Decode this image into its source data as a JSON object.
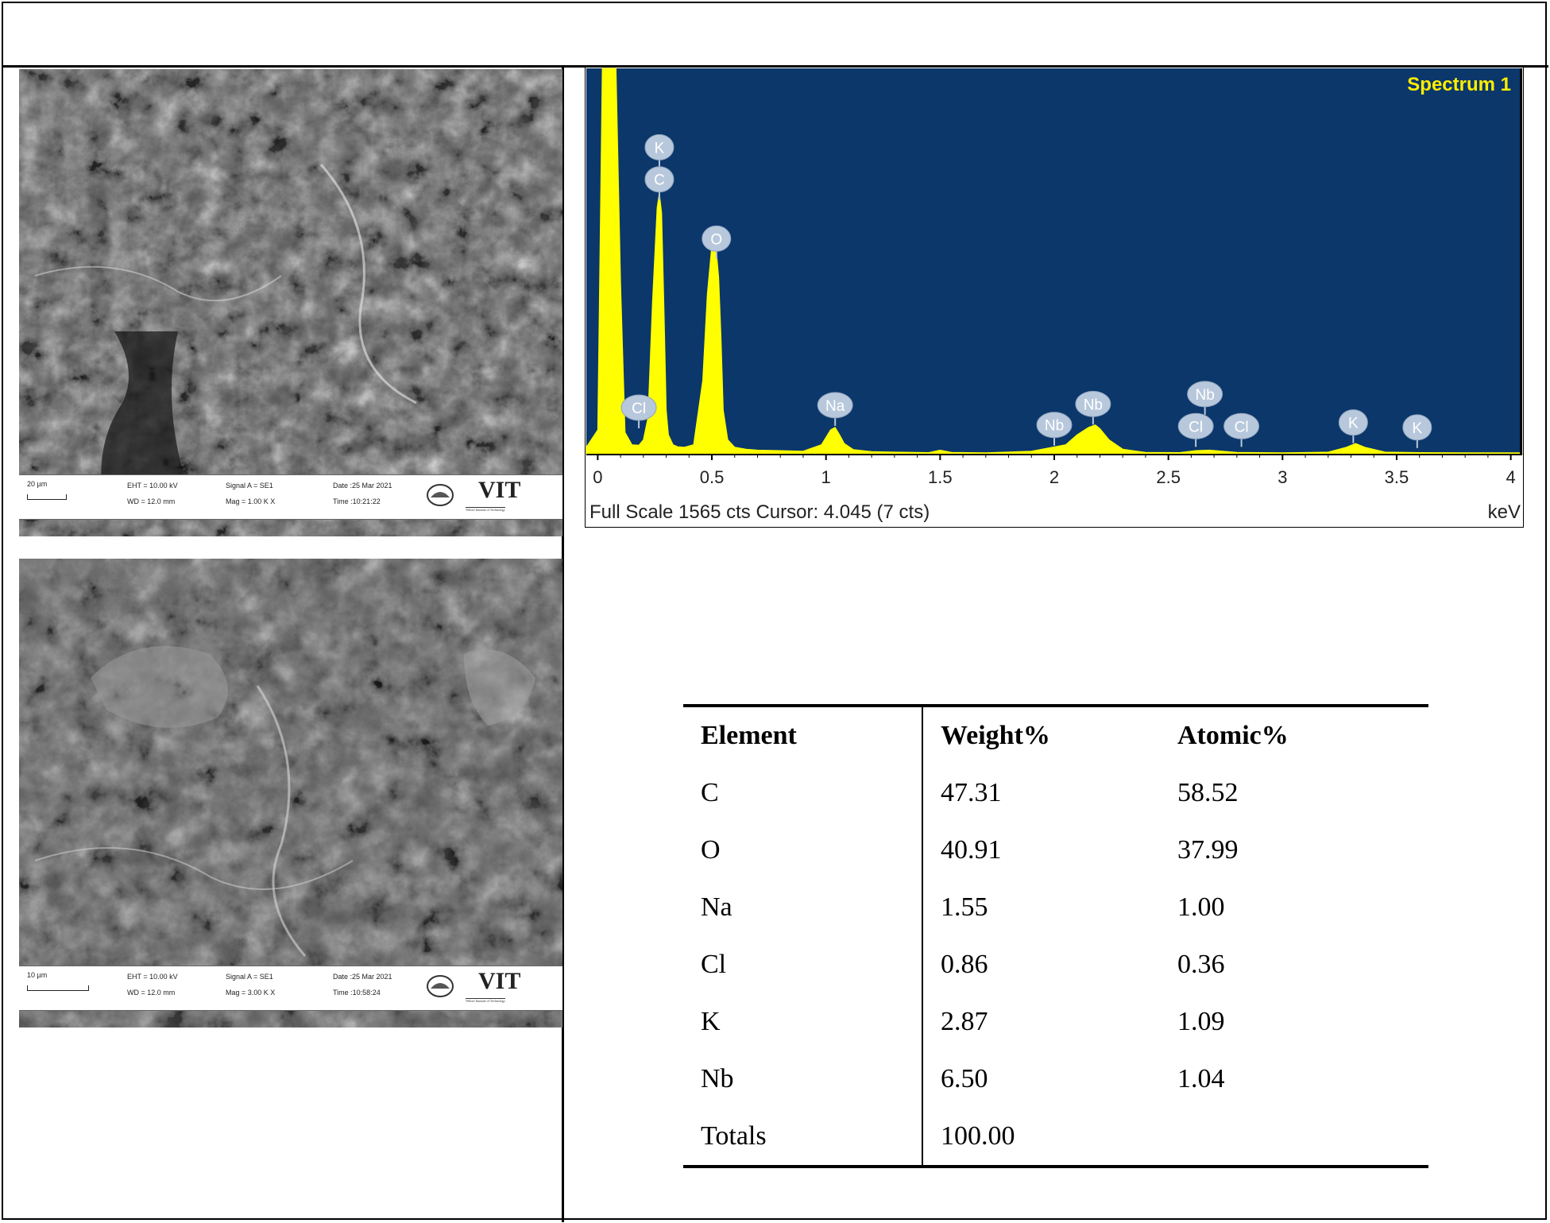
{
  "sem_images": [
    {
      "scale_bar": "20 µm",
      "eht": "EHT = 10.00 kV",
      "wd": "WD = 12.0 mm",
      "signal": "Signal A = SE1",
      "mag": "Mag =   1.00 K X",
      "date": "Date :25 Mar 2021",
      "time": "Time :10:21:22",
      "logo_text": "VIT",
      "logo_sub": "Vellore Institute of Technology"
    },
    {
      "scale_bar": "10 µm",
      "eht": "EHT = 10.00 kV",
      "wd": "WD = 12.0 mm",
      "signal": "Signal A = SE1",
      "mag": "Mag =   3.00 K X",
      "date": "Date :25 Mar 2021",
      "time": "Time :10:58:24",
      "logo_text": "VIT",
      "logo_sub": "Vellore Institute of Technology"
    }
  ],
  "chart_data": {
    "type": "line",
    "spectrum_name": "Spectrum 1",
    "x_unit": "keV",
    "xlim": [
      -0.05,
      4.05
    ],
    "xticks": [
      "0",
      "0.5",
      "1",
      "1.5",
      "2",
      "2.5",
      "3",
      "3.5",
      "4"
    ],
    "full_scale_cts": 1565,
    "status_line": "Full Scale 1565 cts Cursor: 4.045  (7 cts)",
    "grid": false,
    "colors": {
      "background": "#0b376b",
      "fill": "#ffff00",
      "badge": "#b8c8dc",
      "label": "#ffee00"
    },
    "series": [
      {
        "x": [
          -0.05,
          0.0,
          0.02,
          0.04,
          0.06,
          0.08,
          0.1,
          0.12,
          0.15,
          0.18,
          0.2,
          0.22,
          0.24,
          0.26,
          0.27,
          0.28,
          0.29,
          0.3,
          0.31,
          0.33,
          0.35,
          0.38,
          0.42,
          0.46,
          0.48,
          0.5,
          0.52,
          0.53,
          0.54,
          0.55,
          0.57,
          0.6,
          0.65,
          0.7,
          0.8,
          0.9,
          0.98,
          1.02,
          1.04,
          1.06,
          1.08,
          1.12,
          1.2,
          1.3,
          1.45,
          1.5,
          1.55,
          1.7,
          1.9,
          2.05,
          2.1,
          2.15,
          2.18,
          2.2,
          2.24,
          2.3,
          2.4,
          2.55,
          2.62,
          2.68,
          2.8,
          3.0,
          3.2,
          3.28,
          3.32,
          3.36,
          3.45,
          3.6,
          3.8,
          4.0,
          4.05
        ],
        "y": [
          30,
          100,
          1565,
          1565,
          1565,
          1565,
          700,
          90,
          40,
          38,
          60,
          150,
          620,
          1000,
          1060,
          980,
          600,
          180,
          80,
          40,
          32,
          30,
          40,
          300,
          650,
          850,
          820,
          720,
          480,
          180,
          60,
          30,
          22,
          18,
          16,
          14,
          40,
          100,
          110,
          80,
          45,
          20,
          12,
          10,
          8,
          18,
          9,
          7,
          14,
          40,
          80,
          110,
          120,
          105,
          60,
          22,
          9,
          8,
          16,
          18,
          9,
          7,
          10,
          30,
          45,
          30,
          10,
          8,
          7,
          7,
          7
        ]
      }
    ],
    "peak_labels": [
      {
        "text": "K",
        "x": 0.27,
        "level": 1245
      },
      {
        "text": "C",
        "x": 0.27,
        "level": 1115
      },
      {
        "text": "O",
        "x": 0.52,
        "level": 875
      },
      {
        "text": "Cl",
        "x": 0.18,
        "level": 190
      },
      {
        "text": "Na",
        "x": 1.04,
        "level": 200
      },
      {
        "text": "Nb",
        "x": 2.0,
        "level": 120
      },
      {
        "text": "Nb",
        "x": 2.17,
        "level": 205
      },
      {
        "text": "Nb",
        "x": 2.66,
        "level": 245
      },
      {
        "text": "Cl",
        "x": 2.62,
        "level": 115
      },
      {
        "text": "Cl",
        "x": 2.82,
        "level": 115
      },
      {
        "text": "K",
        "x": 3.31,
        "level": 130
      },
      {
        "text": "K",
        "x": 3.59,
        "level": 110
      }
    ]
  },
  "composition_table": {
    "headers": [
      "Element",
      "Weight%",
      "Atomic%"
    ],
    "rows": [
      [
        "C",
        "47.31",
        "58.52"
      ],
      [
        "O",
        "40.91",
        "37.99"
      ],
      [
        "Na",
        "1.55",
        "1.00"
      ],
      [
        "Cl",
        "0.86",
        "0.36"
      ],
      [
        "K",
        "2.87",
        "1.09"
      ],
      [
        "Nb",
        "6.50",
        "1.04"
      ],
      [
        "Totals",
        "100.00",
        ""
      ]
    ]
  }
}
